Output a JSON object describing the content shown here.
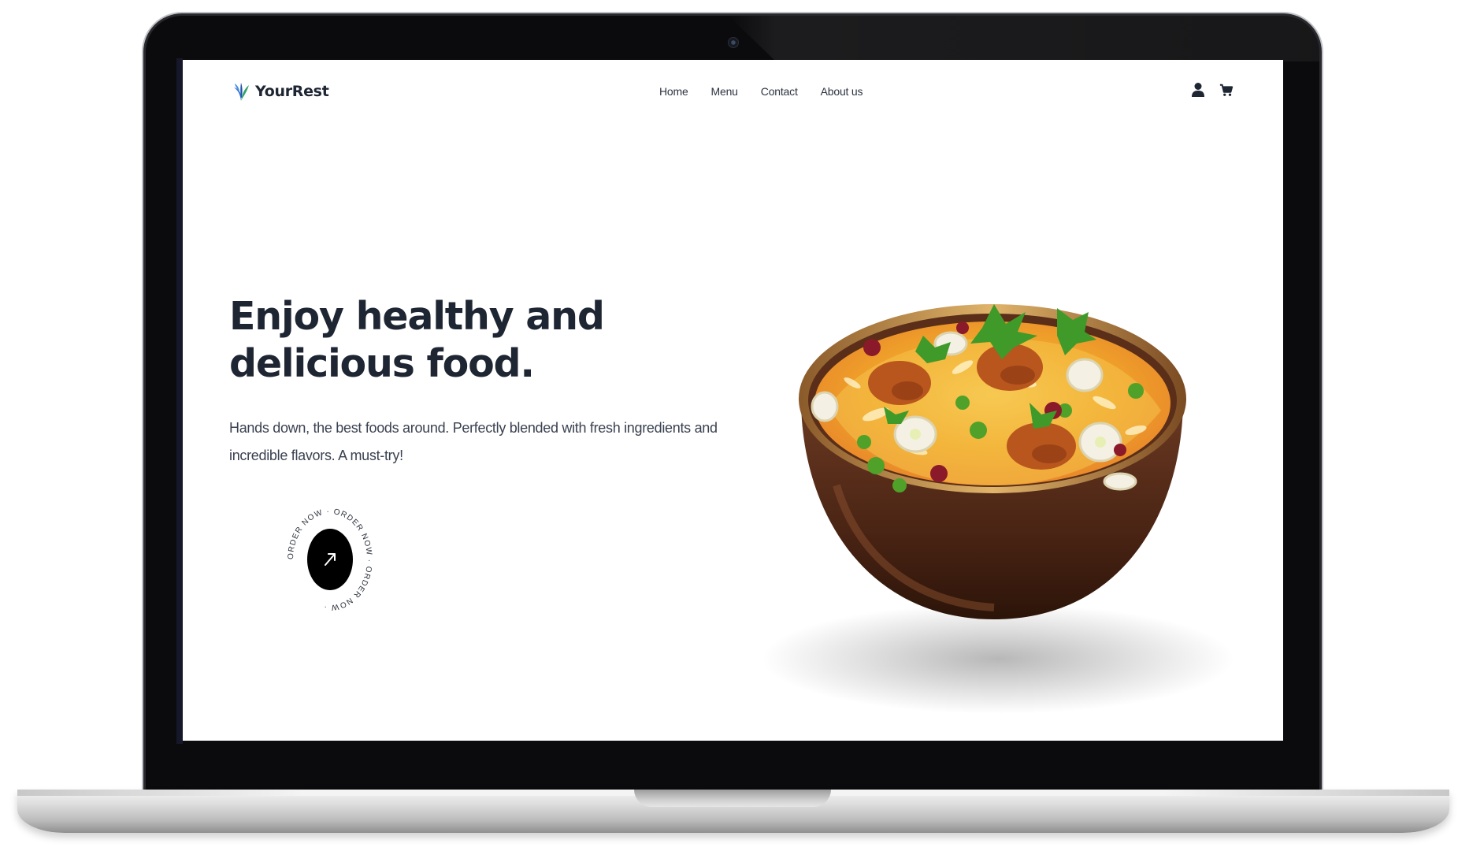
{
  "brand": {
    "name": "YourRest",
    "logo_icon": "leaf-logo-icon"
  },
  "nav": {
    "links": [
      {
        "label": "Home"
      },
      {
        "label": "Menu"
      },
      {
        "label": "Contact"
      },
      {
        "label": "About us"
      }
    ],
    "icons": [
      "user-icon",
      "cart-icon"
    ]
  },
  "hero": {
    "title_line1": "Enjoy healthy and",
    "title_line2": "delicious food.",
    "description": "Hands down, the best foods around. Perfectly blended with fresh ingredients and incredible flavors. A must-try!",
    "order_ring_text": "ORDER NOW · ORDER NOW · ORDER NOW · ",
    "order_icon": "arrow-up-right-icon",
    "image_subject": "biryani-bowl"
  },
  "colors": {
    "text_dark": "#1f2633",
    "accent_blue": "#2f6fd6",
    "accent_green": "#2fa36b",
    "button_black": "#000000"
  }
}
